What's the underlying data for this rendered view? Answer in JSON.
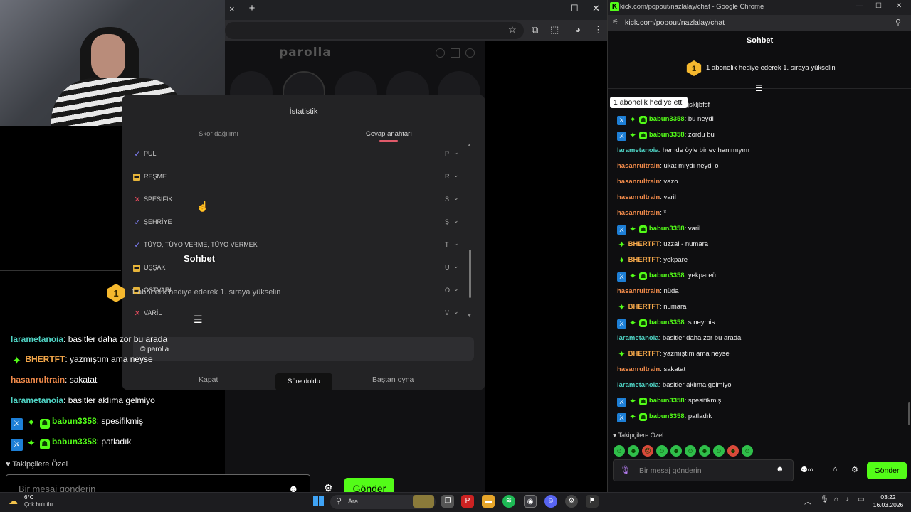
{
  "left_window": {
    "tab_close": "×",
    "tab_new": "+",
    "controls": [
      "—",
      "☐",
      "✕"
    ],
    "addr_icons": [
      "☆",
      "⧉",
      "⬚",
      "◕",
      "⋮"
    ]
  },
  "parolla": {
    "logo": "parolla"
  },
  "modal": {
    "title": "İstatistik",
    "tabs": [
      "Skor dağılımı",
      "Cevap anahtarı"
    ],
    "answers": [
      {
        "status": "correct",
        "word": "PUL",
        "letter": "P"
      },
      {
        "status": "pass",
        "word": "REŞME",
        "letter": "R"
      },
      {
        "status": "wrong",
        "word": "SPESİFİK",
        "letter": "S"
      },
      {
        "status": "correct",
        "word": "ŞEHRİYE",
        "letter": "Ş"
      },
      {
        "status": "correct",
        "word": "TÜYO, TÜYO VERME, TÜYO VERMEK",
        "letter": "T"
      },
      {
        "status": "pass",
        "word": "UŞŞAK",
        "letter": "U"
      },
      {
        "status": "pass",
        "word": "ÖSTVARI",
        "letter": "Ö"
      },
      {
        "status": "wrong",
        "word": "VARİL",
        "letter": "V"
      }
    ],
    "copyright": "© parolla",
    "close_btn": "Kapat",
    "time_btn": "Süre doldu",
    "restart_btn": "Baştan oyna"
  },
  "overlay_chat": {
    "title": "Sohbet",
    "gift_badge": "1",
    "gift_text": "1 abonelik hediye ederek 1. sıraya yükselin",
    "messages": [
      {
        "user": "larametanoia",
        "color": "#4fd3c4",
        "badges": [],
        "text": "basitler daha zor bu arada"
      },
      {
        "user": "BHERTFT",
        "color": "#f5a84a",
        "badges": [
          "vip"
        ],
        "text": "yazmıştım ama neyse"
      },
      {
        "user": "hasanrultrain",
        "color": "#f08a4a",
        "badges": [],
        "text": "sakatat"
      },
      {
        "user": "larametanoia",
        "color": "#4fd3c4",
        "badges": [],
        "text": "basitler aklıma gelmiyo"
      },
      {
        "user": "babun3358",
        "color": "#53fc18",
        "badges": [
          "mod",
          "vip",
          "sub"
        ],
        "text": "spesifikmiş"
      },
      {
        "user": "babun3358",
        "color": "#53fc18",
        "badges": [
          "mod",
          "vip",
          "sub"
        ],
        "text": "patladık"
      }
    ],
    "followers_label": "♥ Takipçilere Özel",
    "input_placeholder": "Bir mesaj gönderin",
    "emoji_icon": "☻",
    "settings_icon": "⚙",
    "send_label": "Gönder"
  },
  "right_window": {
    "kick_icon": "K",
    "title": "kick.com/popout/nazlalay/chat - Google Chrome",
    "controls": [
      "—",
      "☐",
      "✕"
    ],
    "url": "kick.com/popout/nazlalay/chat",
    "chat_title": "Sohbet",
    "gift_badge": "1",
    "gift_text": "1 abonelik hediye ederek 1. sıraya yükselin",
    "tooltip": "1 abonelik hediye etti",
    "tooltip_rest": "jskljbfsf",
    "messages": [
      {
        "user": "babun3358",
        "color": "#53fc18",
        "badges": [
          "mod",
          "vip",
          "sub"
        ],
        "text": "bu neydi"
      },
      {
        "user": "babun3358",
        "color": "#53fc18",
        "badges": [
          "mod",
          "vip",
          "sub"
        ],
        "text": "zordu bu"
      },
      {
        "user": "larametanoia",
        "color": "#4fd3c4",
        "badges": [],
        "text": "hemde öyle bir ev hanımıyım"
      },
      {
        "user": "hasanrultrain",
        "color": "#f08a4a",
        "badges": [],
        "text": "ukat mıydı neydi o"
      },
      {
        "user": "hasanrultrain",
        "color": "#f08a4a",
        "badges": [],
        "text": "vazo"
      },
      {
        "user": "hasanrultrain",
        "color": "#f08a4a",
        "badges": [],
        "text": "varil"
      },
      {
        "user": "hasanrultrain",
        "color": "#f08a4a",
        "badges": [],
        "text": "*"
      },
      {
        "user": "babun3358",
        "color": "#53fc18",
        "badges": [
          "mod",
          "vip",
          "sub"
        ],
        "text": "varil"
      },
      {
        "user": "BHERTFT",
        "color": "#f5a84a",
        "badges": [
          "vip"
        ],
        "text": "uzzal - numara"
      },
      {
        "user": "BHERTFT",
        "color": "#f5a84a",
        "badges": [
          "vip"
        ],
        "text": "yekpare"
      },
      {
        "user": "babun3358",
        "color": "#53fc18",
        "badges": [
          "mod",
          "vip",
          "sub"
        ],
        "text": "yekpareü"
      },
      {
        "user": "hasanrultrain",
        "color": "#f08a4a",
        "badges": [],
        "text": "nüda"
      },
      {
        "user": "BHERTFT",
        "color": "#f5a84a",
        "badges": [
          "vip"
        ],
        "text": "numara"
      },
      {
        "user": "babun3358",
        "color": "#53fc18",
        "badges": [
          "mod",
          "vip",
          "sub"
        ],
        "text": "s neymis"
      },
      {
        "user": "larametanoia",
        "color": "#4fd3c4",
        "badges": [],
        "text": "basitler daha zor bu arada"
      },
      {
        "user": "BHERTFT",
        "color": "#f5a84a",
        "badges": [
          "vip"
        ],
        "text": "yazmıştım ama neyse"
      },
      {
        "user": "hasanrultrain",
        "color": "#f08a4a",
        "badges": [],
        "text": "sakatat"
      },
      {
        "user": "larametanoia",
        "color": "#4fd3c4",
        "badges": [],
        "text": "basitler aklıma gelmiyo"
      },
      {
        "user": "babun3358",
        "color": "#53fc18",
        "badges": [
          "mod",
          "vip",
          "sub"
        ],
        "text": "spesifikmiş"
      },
      {
        "user": "babun3358",
        "color": "#53fc18",
        "badges": [
          "mod",
          "vip",
          "sub"
        ],
        "text": "patladık"
      }
    ],
    "followers_label": "♥ Takipçilere Özel",
    "emotes": [
      "☺",
      "☻",
      "☹",
      "☺",
      "☻",
      "☺",
      "☻",
      "☺",
      "☻",
      "☺"
    ],
    "input_placeholder": "Bir mesaj gönderin",
    "emoji_icon": "☻",
    "send_label": "Gönder"
  },
  "taskbar": {
    "temp": "6°C",
    "weather": "Çok bulutlu",
    "search_placeholder": "Ara",
    "tray_chevron": "︿",
    "time": "03:22",
    "date": "16.03.2026"
  },
  "colors": {
    "kick_green": "#53fc18",
    "mod_blue": "#1d7fd6",
    "wrong_red": "#e04a5c",
    "correct_purple": "#7c7cf0",
    "pass_yellow": "#e6b43a"
  }
}
